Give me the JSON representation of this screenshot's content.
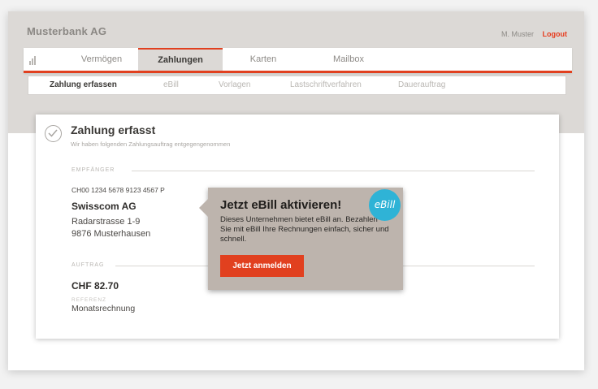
{
  "header": {
    "bank_name": "Musterbank AG",
    "user_name": "M. Muster",
    "logout_label": "Logout"
  },
  "main_nav": {
    "icon": "bar-chart-icon",
    "tabs": [
      {
        "label": "Vermögen",
        "active": false
      },
      {
        "label": "Zahlungen",
        "active": true
      },
      {
        "label": "Karten",
        "active": false
      },
      {
        "label": "Mailbox",
        "active": false
      }
    ]
  },
  "sub_nav": {
    "items": [
      {
        "label": "Zahlung erfassen",
        "active": true
      },
      {
        "label": "eBill",
        "active": false
      },
      {
        "label": "Vorlagen",
        "active": false
      },
      {
        "label": "Lastschriftverfahren",
        "active": false
      },
      {
        "label": "Dauerauftrag",
        "active": false
      }
    ]
  },
  "confirmation": {
    "icon": "checkmark-circle-icon",
    "title": "Zahlung erfasst",
    "subtitle": "Wir haben folgenden Zahlungsauftrag entgegengenommen",
    "recipient_section_label": "EMPFÄNGER",
    "iban": "CH00 1234 5678 9123 4567 P",
    "recipient_name": "Swisscom AG",
    "address_line1": "Radarstrasse 1-9",
    "address_line2": "9876 Musterhausen",
    "order_section_label": "AUFTRAG",
    "amount": "CHF 82.70",
    "reference_label": "REFERENZ",
    "reference_value": "Monatsrechnung"
  },
  "popup": {
    "title": "Jetzt eBill aktivieren!",
    "text": "Dieses Unternehmen bietet eBill an. Bezahlen Sie mit eBill Ihre Rechnungen einfach, sicher und schnell.",
    "button_label": "Jetzt anmelden",
    "badge_label": "eBill"
  },
  "colors": {
    "accent": "#e1401f",
    "ebill_badge": "#2fb3d6",
    "popup_background": "#bdb4ad",
    "header_band": "#dcd9d6"
  }
}
